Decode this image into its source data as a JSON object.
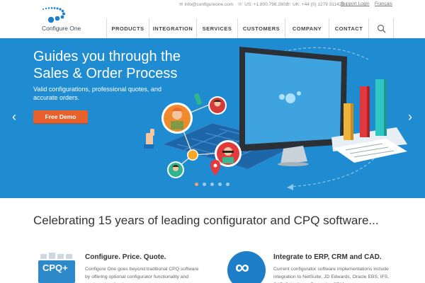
{
  "topbar": {
    "email": "info@configureone.com",
    "phone_us": "US: +1.800.798.2802",
    "phone_uk": "UK: +44 (0) 1279 311420",
    "support_login": "Support Login",
    "language": "Français"
  },
  "logo": {
    "text": "Configure One"
  },
  "nav": {
    "items": [
      "PRODUCTS",
      "INTEGRATION",
      "SERVICES",
      "CUSTOMERS",
      "COMPANY",
      "CONTACT"
    ]
  },
  "hero": {
    "headline": "Guides you through the Sales & Order Process",
    "subtext": "Valid configurations, professional quotes, and accurate orders.",
    "button_label": "Free Demo",
    "prev_arrow": "‹",
    "next_arrow": "›",
    "slide_count": 5,
    "active_slide": 1
  },
  "tagline": "Celebrating 15 years of leading configurator and CPQ software...",
  "features": [
    {
      "title": "Configure. Price. Quote.",
      "icon_label": "CPQ+",
      "text": "Configure One goes beyond traditional CPQ software by offering optional configurator functionality and product visualization"
    },
    {
      "title": "Integrate to ERP, CRM and CAD.",
      "icon_label": "∞",
      "text": "Current configurator software implementations include integration to NetSuite, JD Edwards, Oracle EBS, IFS, SAP, Salesforce, Dynamics CRM"
    }
  ],
  "colors": {
    "hero_bg": "#1f8bd0",
    "cta_orange": "#e8612c",
    "cpq_blue": "#2d89c9",
    "logo_blue": "#1e7fc9"
  }
}
